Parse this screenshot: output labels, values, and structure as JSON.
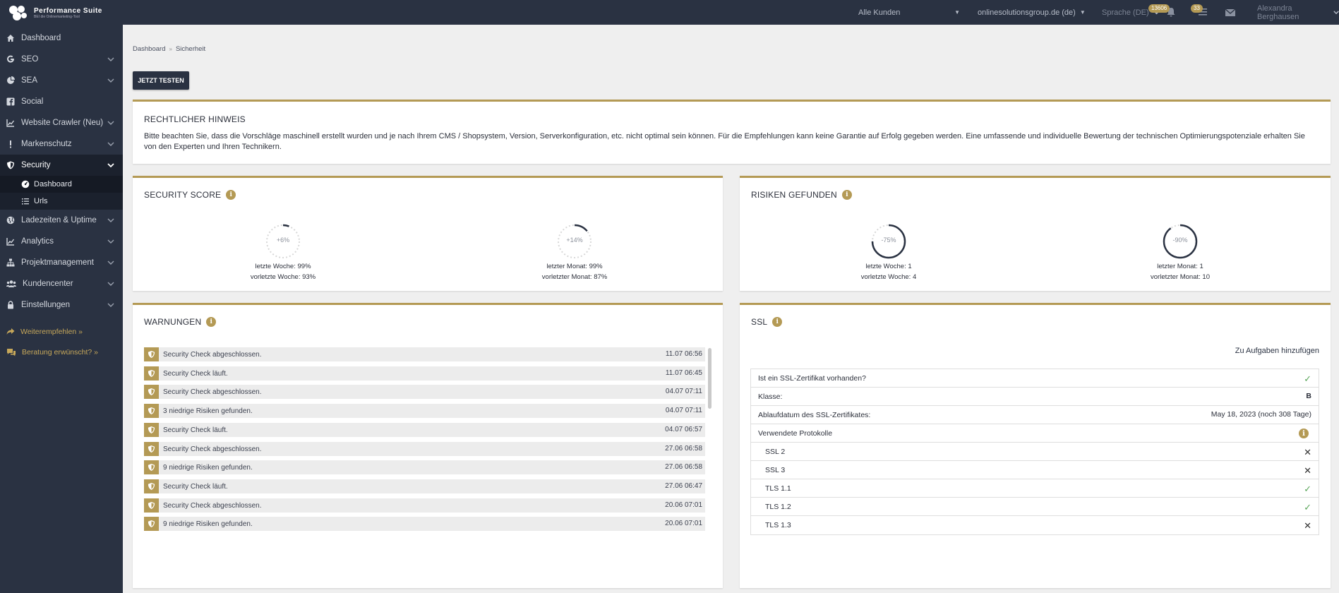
{
  "topbar": {
    "logo_title": "Performance Suite",
    "logo_sub": "BEI die Onlinemarketing-Tool",
    "customer_select": "Alle Kunden",
    "domain_select": "onlinesolutionsgroup.de (de)",
    "language_select": "Sprache (DE)",
    "credits_badge": "13606",
    "notifications_badge": "33",
    "user_name": "Alexandra Berghausen"
  },
  "sidebar": {
    "items": [
      {
        "label": "Dashboard"
      },
      {
        "label": "SEO"
      },
      {
        "label": "SEA"
      },
      {
        "label": "Social"
      },
      {
        "label": "Website Crawler (Neu)"
      },
      {
        "label": "Markenschutz"
      },
      {
        "label": "Security"
      },
      {
        "label": "Ladezeiten & Uptime"
      },
      {
        "label": "Analytics"
      },
      {
        "label": "Projektmanagement"
      },
      {
        "label": "Kundencenter"
      },
      {
        "label": "Einstellungen"
      }
    ],
    "security_sub": [
      {
        "label": "Dashboard"
      },
      {
        "label": "Urls"
      }
    ],
    "links": [
      {
        "label": "Weiterempfehlen »"
      },
      {
        "label": "Beratung erwünscht? »"
      }
    ]
  },
  "breadcrumb": {
    "home": "Dashboard",
    "separator": "»",
    "current": "Sicherheit"
  },
  "test_button": "JETZT TESTEN",
  "notice": {
    "title": "RECHTLICHER HINWEIS",
    "text": "Bitte beachten Sie, dass die Vorschläge maschinell erstellt wurden und je nach Ihrem CMS / Shopsystem, Version, Serverkonfiguration, etc. nicht optimal sein können. Für die Empfehlungen kann keine Garantie auf Erfolg gegeben werden. Eine umfassende und individuelle Bewertung der technischen Optimierungspotenziale erhalten Sie von den Experten und Ihren Technikern."
  },
  "security_score": {
    "title": "SECURITY SCORE",
    "gauges": [
      {
        "value": "+6%",
        "fraction": 0.06,
        "line1_label": "letzte Woche:",
        "line1_value": "99%",
        "line2_label": "vorletzte Woche:",
        "line2_value": "93%"
      },
      {
        "value": "+14%",
        "fraction": 0.14,
        "line1_label": "letzter Monat:",
        "line1_value": "99%",
        "line2_label": "vorletzter Monat:",
        "line2_value": "87%"
      }
    ]
  },
  "risks": {
    "title": "RISIKEN GEFUNDEN",
    "gauges": [
      {
        "value": "-75%",
        "fraction": 0.75,
        "line1_label": "letzte Woche:",
        "line1_value": "1",
        "line2_label": "vorletzte Woche:",
        "line2_value": "4"
      },
      {
        "value": "-90%",
        "fraction": 0.9,
        "line1_label": "letzter Monat:",
        "line1_value": "1",
        "line2_label": "vorletzter Monat:",
        "line2_value": "10"
      }
    ]
  },
  "warnings": {
    "title": "WARNUNGEN",
    "rows": [
      {
        "text": "Security Check abgeschlossen.",
        "time": "11.07 06:56"
      },
      {
        "text": "Security Check läuft.",
        "time": "11.07 06:45"
      },
      {
        "text": "Security Check abgeschlossen.",
        "time": "04.07 07:11"
      },
      {
        "text": "3 niedrige Risiken gefunden.",
        "time": "04.07 07:11"
      },
      {
        "text": "Security Check läuft.",
        "time": "04.07 06:57"
      },
      {
        "text": "Security Check abgeschlossen.",
        "time": "27.06 06:58"
      },
      {
        "text": "9 niedrige Risiken gefunden.",
        "time": "27.06 06:58"
      },
      {
        "text": "Security Check läuft.",
        "time": "27.06 06:47"
      },
      {
        "text": "Security Check abgeschlossen.",
        "time": "20.06 07:01"
      },
      {
        "text": "9 niedrige Risiken gefunden.",
        "time": "20.06 07:01"
      }
    ]
  },
  "ssl": {
    "title": "SSL",
    "add_task_link": "Zu Aufgaben hinzufügen",
    "rows": [
      {
        "label": "Ist ein SSL-Zertifikat vorhanden?",
        "status": "check"
      },
      {
        "label": "Klasse:",
        "value": "B"
      },
      {
        "label": "Ablaufdatum des SSL-Zertifikates:",
        "value": "May 18, 2023 (noch 308 Tage)"
      },
      {
        "label": "Verwendete Protokolle",
        "status": "info"
      },
      {
        "label": "SSL 2",
        "status": "cross"
      },
      {
        "label": "SSL 3",
        "status": "cross"
      },
      {
        "label": "TLS 1.1",
        "status": "check"
      },
      {
        "label": "TLS 1.2",
        "status": "check"
      },
      {
        "label": "TLS 1.3",
        "status": "cross"
      }
    ]
  },
  "colors": {
    "accent": "#b49a55",
    "dark": "#2a3242",
    "check": "#5aa65a"
  }
}
